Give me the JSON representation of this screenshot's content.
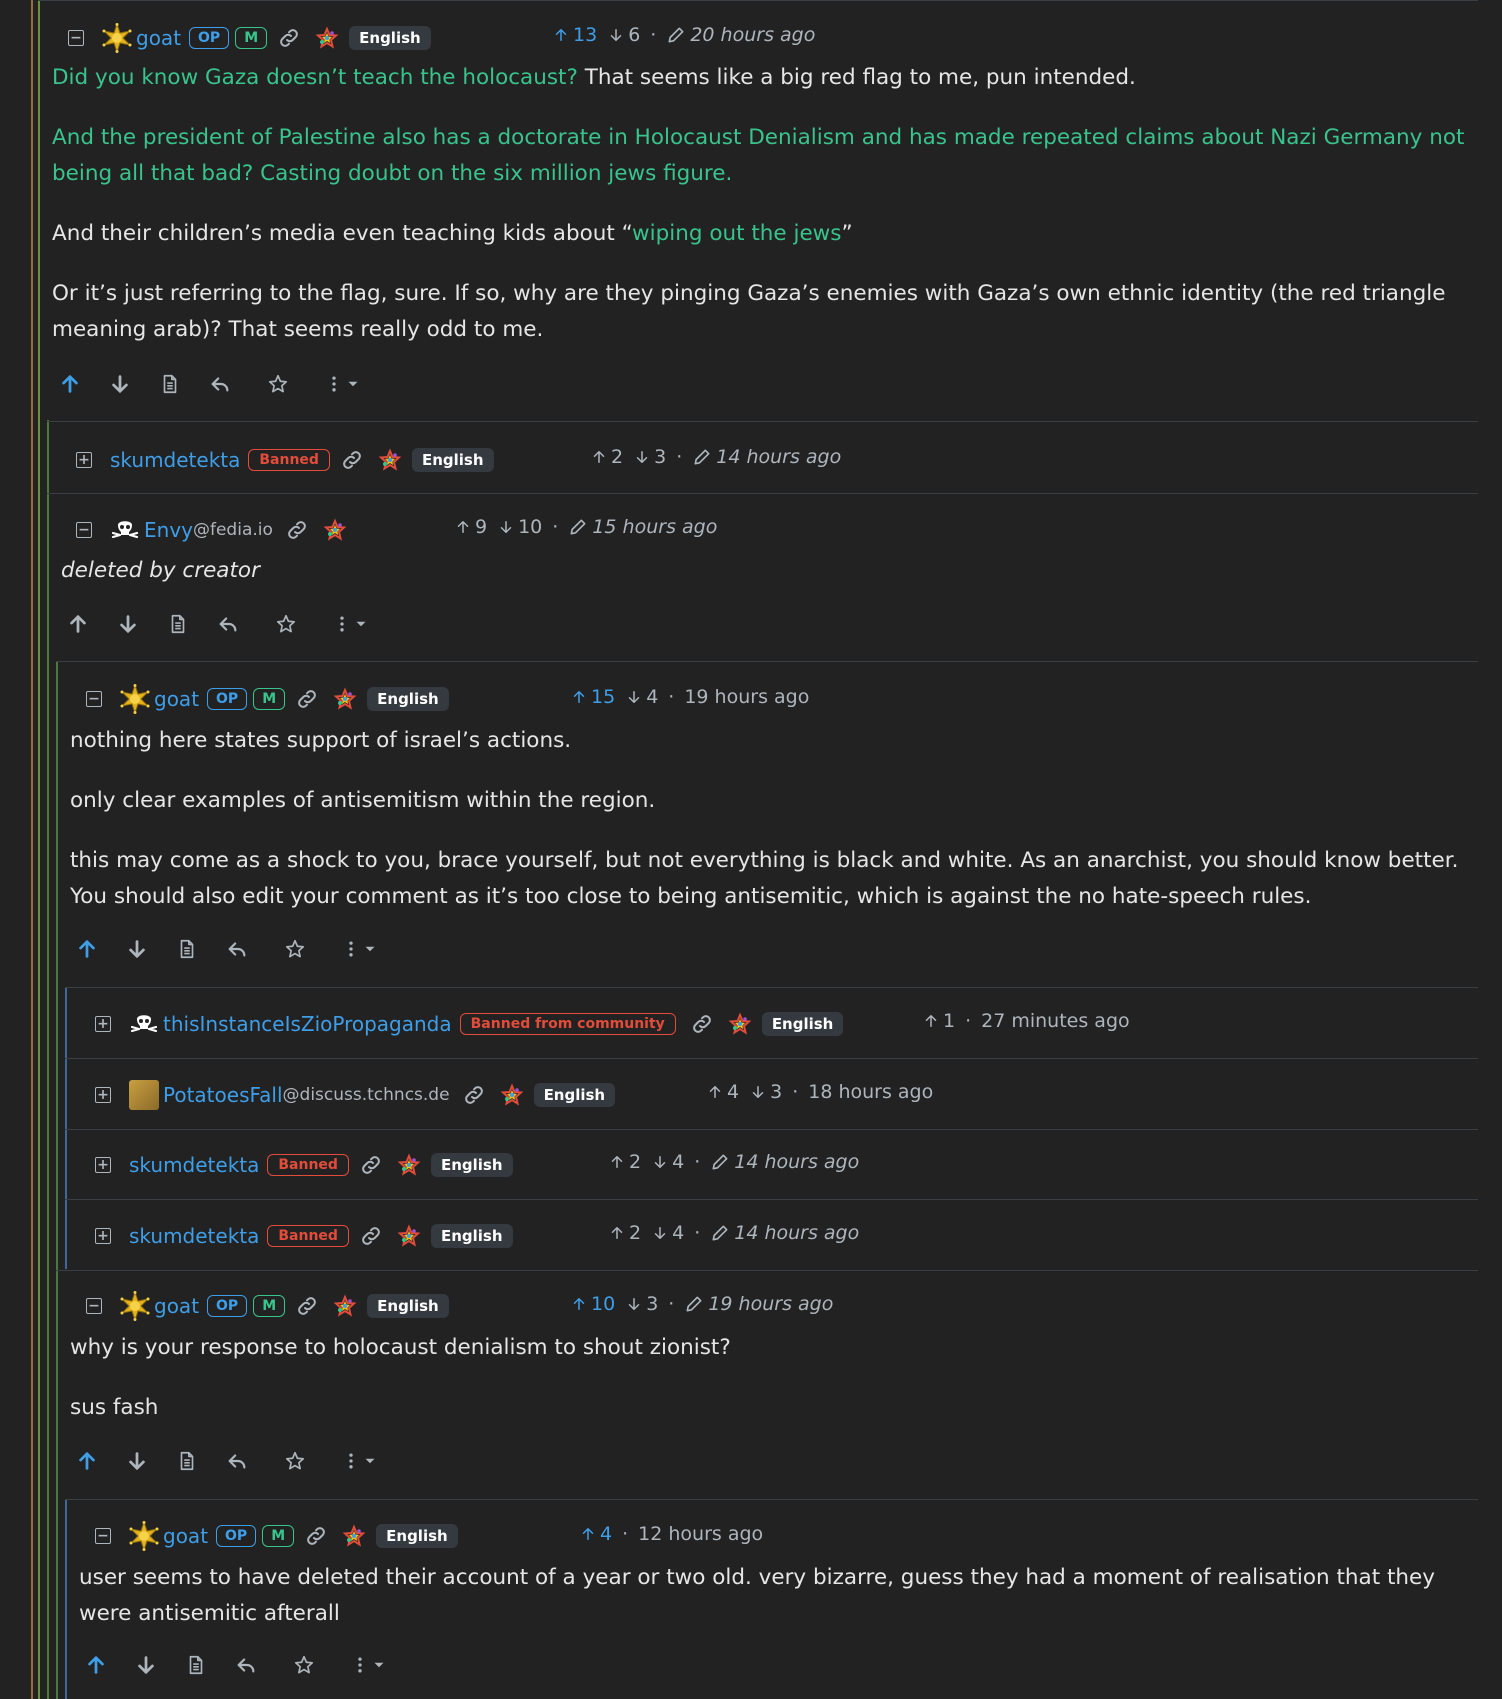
{
  "colors": {
    "background": "#222222",
    "link": "#3e9ee8",
    "green": "#38c48c",
    "banned": "#e24c3a"
  },
  "comments": [
    {
      "user": "goat",
      "op": "OP",
      "mod": "M",
      "lang": "English",
      "up": "13",
      "down": "6",
      "time": "20 hours ago",
      "edited": true,
      "paragraphs": [
        {
          "link": "Did you know Gaza doesn’t teach the holocaust?",
          "text": " That seems like a big red flag to me, pun intended."
        },
        {
          "link": "And the president of Palestine also has a doctorate in Holocaust Denialism and has made repeated claims about Nazi Germany not being all that bad? Casting doubt on the six million jews figure.",
          "text": ""
        },
        {
          "pre": "And their children’s media even teaching kids about “",
          "link": "wiping out the jews",
          "text": "”"
        },
        {
          "text": "Or it’s just referring to the flag, sure. If so, why are they pinging Gaza’s enemies with Gaza’s own ethnic identity (the red triangle meaning arab)? That seems really odd to me."
        }
      ]
    },
    {
      "user": "skumdetekta",
      "badge": "Banned",
      "lang": "English",
      "up": "2",
      "down": "3",
      "time": "14 hours ago"
    },
    {
      "user": "Envy",
      "instance": "@fedia.io",
      "up": "9",
      "down": "10",
      "time": "15 hours ago",
      "body": "deleted by creator"
    },
    {
      "user": "goat",
      "op": "OP",
      "mod": "M",
      "lang": "English",
      "up": "15",
      "down": "4",
      "time": "19 hours ago",
      "paragraphs": [
        "nothing here states support of israel’s actions.",
        "only clear examples of antisemitism within the region.",
        "this may come as a shock to you, brace yourself, but not everything is black and white. As an anarchist, you should know better. You should also edit your comment as it’s too close to being antisemitic, which is against the no hate-speech rules."
      ]
    },
    {
      "user": "thisInstanceIsZioPropaganda",
      "badge": "Banned from community",
      "lang": "English",
      "up": "1",
      "time": "27 minutes ago"
    },
    {
      "user": "PotatoesFall",
      "instance": "@discuss.tchncs.de",
      "lang": "English",
      "up": "4",
      "down": "3",
      "time": "18 hours ago"
    },
    {
      "user": "skumdetekta",
      "badge": "Banned",
      "lang": "English",
      "up": "2",
      "down": "4",
      "time": "14 hours ago"
    },
    {
      "user": "skumdetekta",
      "badge": "Banned",
      "lang": "English",
      "up": "2",
      "down": "4",
      "time": "14 hours ago"
    },
    {
      "user": "goat",
      "op": "OP",
      "mod": "M",
      "lang": "English",
      "up": "10",
      "down": "3",
      "time": "19 hours ago",
      "paragraphs": [
        "why is your response to holocaust denialism to shout zionist?",
        "sus fash"
      ]
    },
    {
      "user": "goat",
      "op": "OP",
      "mod": "M",
      "lang": "English",
      "up": "4",
      "time": "12 hours ago",
      "paragraphs": [
        "user seems to have deleted their account of a year or two old. very bizarre, guess they had a moment of realisation that they were antisemitic afterall"
      ]
    }
  ]
}
